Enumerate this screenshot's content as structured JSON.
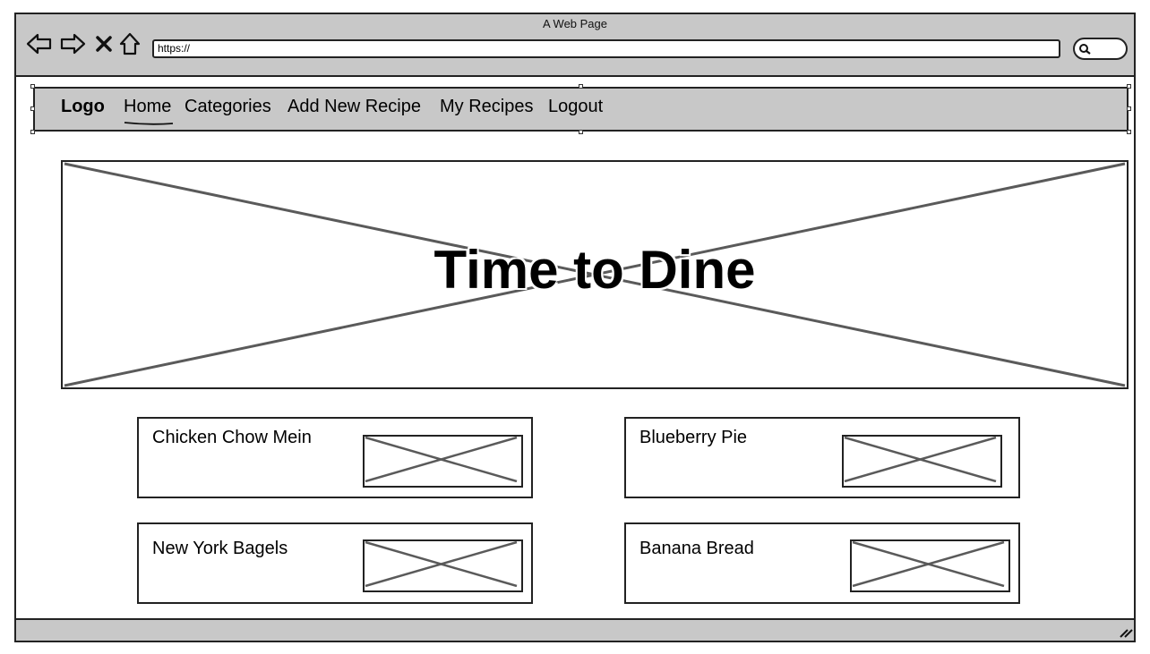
{
  "window": {
    "title": "A Web Page",
    "url": "https://"
  },
  "icons": {
    "back": "back-arrow-icon",
    "forward": "forward-arrow-icon",
    "stop": "close-icon",
    "home": "home-icon",
    "search": "search-icon",
    "resize": "resize-grip-icon"
  },
  "navbar": {
    "logo": "Logo",
    "items": [
      {
        "label": "Home",
        "active": true
      },
      {
        "label": "Categories"
      },
      {
        "label": "Add New Recipe"
      },
      {
        "label": "My Recipes"
      },
      {
        "label": "Logout"
      }
    ]
  },
  "hero": {
    "title": "Time to Dine"
  },
  "recipes": [
    {
      "title": "Chicken Chow Mein"
    },
    {
      "title": "Blueberry Pie"
    },
    {
      "title": "New York Bagels"
    },
    {
      "title": "Banana Bread"
    }
  ],
  "colors": {
    "chrome": "#c8c8c8",
    "border": "#222222",
    "placeholder_lines": "#5a5a5a"
  }
}
